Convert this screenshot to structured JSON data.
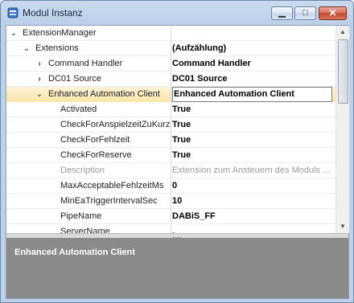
{
  "window": {
    "title": "Modul Instanz",
    "min_glyph": "▁",
    "max_glyph": "□",
    "close_glyph": "✕"
  },
  "grid": {
    "rows": [
      {
        "name": "ExtensionManager",
        "value": "",
        "expander": "⌄"
      },
      {
        "name": "Extensions",
        "value": "(Aufzählung)",
        "expander": "⌄"
      },
      {
        "name": "Command Handler",
        "value": "Command Handler",
        "expander": "›"
      },
      {
        "name": "DC01 Source",
        "value": "DC01 Source",
        "expander": "›"
      },
      {
        "name": "Enhanced Automation Client",
        "value": "Enhanced Automation Client",
        "expander": "⌄"
      },
      {
        "name": "Activated",
        "value": "True"
      },
      {
        "name": "CheckForAnspielzeitZuKurz",
        "value": "True"
      },
      {
        "name": "CheckForFehlzeit",
        "value": "True"
      },
      {
        "name": "CheckForReserve",
        "value": "True"
      },
      {
        "name": "Description",
        "value": "Extension zum Ansteuern des Moduls ..."
      },
      {
        "name": "MaxAcceptableFehlzeitMs",
        "value": "0"
      },
      {
        "name": "MinEaTriggerIntervalSec",
        "value": "10"
      },
      {
        "name": "PipeName",
        "value": "DABiS_FF"
      },
      {
        "name": "ServerName",
        "value": "."
      }
    ]
  },
  "description_panel": {
    "title": "Enhanced Automation Client"
  },
  "colors": {
    "title_bg": "#c9daee",
    "selected_row": "#fbe6a8",
    "desc_bg": "#8a8a8a"
  },
  "scrollbar": {
    "up_glyph": "▲",
    "down_glyph": "▼"
  },
  "splitter": {
    "grip": "....."
  }
}
